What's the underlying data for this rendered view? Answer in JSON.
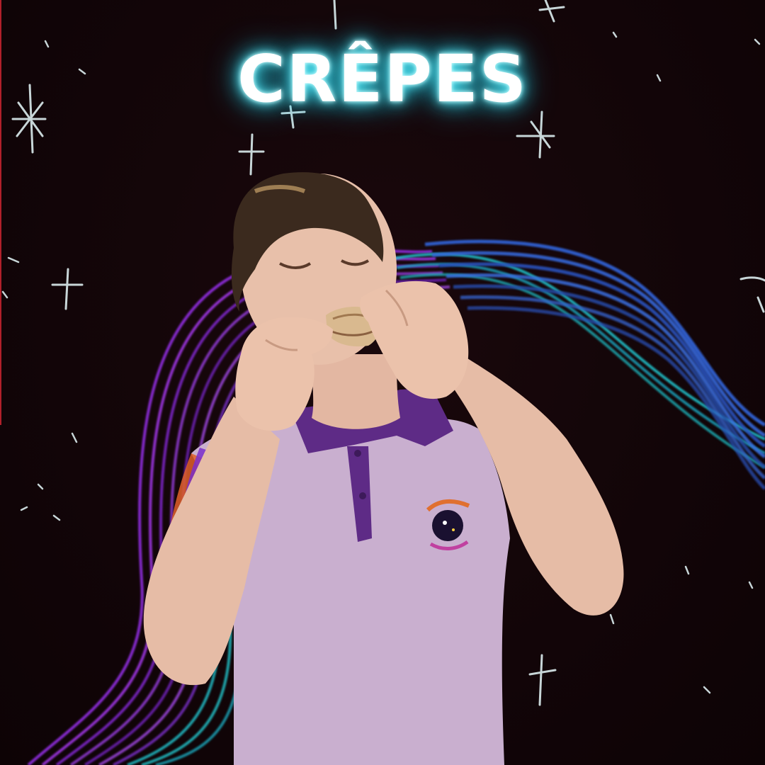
{
  "poster": {
    "title": "CRÊPES"
  },
  "icons": {
    "sparkle": "sparkle-icon",
    "shirt_emblem": "planet-emblem-icon"
  },
  "colors": {
    "background": "#120508",
    "title_glow": "#2fd9ee",
    "wave_purple": "#8a2bd6",
    "wave_blue": "#2f5fd0",
    "wave_teal": "#1fc6cf",
    "shirt": "#c9afcf",
    "collar": "#5e2b86",
    "doodle": "#c8d6d8"
  }
}
